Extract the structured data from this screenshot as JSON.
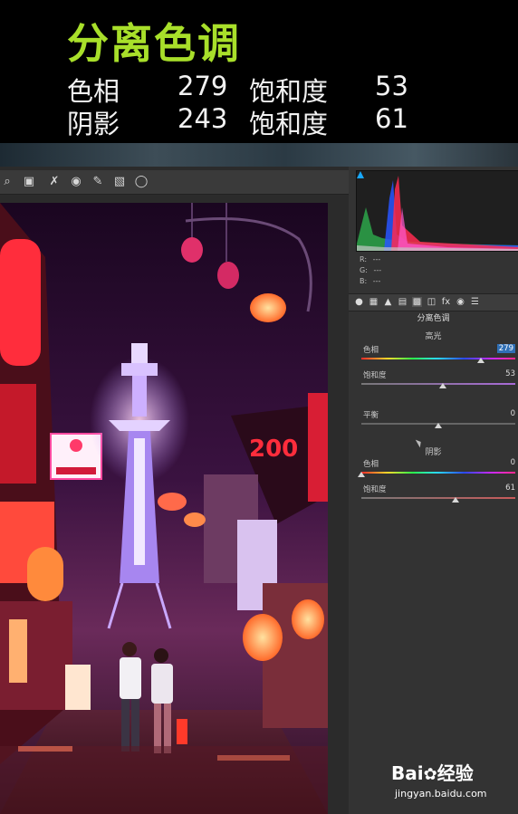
{
  "caption": {
    "title": "分离色调",
    "rows": [
      {
        "label": "色相",
        "value": "279",
        "label2": "饱和度",
        "value2": "53"
      },
      {
        "label": "阴影",
        "value": "243",
        "label2": "饱和度",
        "value2": "61"
      }
    ]
  },
  "toolbar": {
    "tools": [
      "zoom-icon",
      "crop-icon",
      "spot-removal-icon",
      "red-eye-icon",
      "brush-icon",
      "gradient-icon",
      "radial-icon"
    ]
  },
  "histogram": {
    "r_label": "R:",
    "r_value": "---",
    "g_label": "G:",
    "g_value": "---",
    "b_label": "B:",
    "b_value": "---"
  },
  "panel": {
    "tabs": [
      "basic-icon",
      "tone-curve-icon",
      "detail-icon",
      "hsl-icon",
      "split-toning-icon",
      "lens-icon",
      "fx-icon",
      "camera-icon",
      "presets-icon"
    ],
    "title": "分离色调",
    "highlights": {
      "section": "高光",
      "hue_label": "色相",
      "hue_value": "279",
      "hue_fraction": 0.775,
      "sat_label": "饱和度",
      "sat_value": "53",
      "sat_fraction": 0.53
    },
    "balance": {
      "label": "平衡",
      "value": "0",
      "fraction": 0.5
    },
    "shadows": {
      "section": "阴影",
      "hue_label": "色相",
      "hue_value": "0",
      "hue_fraction": 0.0,
      "sat_label": "饱和度",
      "sat_value": "61",
      "sat_fraction": 0.61
    }
  },
  "watermark": {
    "brand": "Bai",
    "brand_suffix": "经验",
    "url": "jingyan.baidu.com"
  },
  "colors": {
    "title": "#a8df2a",
    "accent": "#2f6fb5",
    "neon_red": "#ff2d3c",
    "neon_violet": "#b98cff"
  }
}
